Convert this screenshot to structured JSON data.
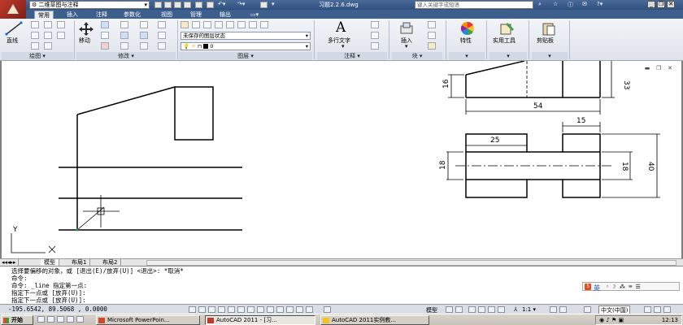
{
  "title": {
    "workspace": "二维草图与注释",
    "document": "习题2.2.6.dwg",
    "search_placeholder": "键入关键字或短语"
  },
  "tabs": [
    "常用",
    "插入",
    "注释",
    "参数化",
    "视图",
    "管理",
    "输出"
  ],
  "ribbon": {
    "line_label": "直线",
    "move_label": "移动",
    "layer_state": "未保存的图层状态",
    "layer_current": "0",
    "mtext_label": "多行文字",
    "insert_label": "插入",
    "properties_label": "特性",
    "utilities_label": "实用工具",
    "clipboard_label": "剪贴板",
    "panels": {
      "draw": "绘图",
      "modify": "修改",
      "layers": "图层",
      "annotation": "注释",
      "block": "块"
    }
  },
  "drawing": {
    "dims": [
      "16",
      "33",
      "54",
      "15",
      "25",
      "18",
      "18",
      "40"
    ],
    "ucs_x": "X",
    "ucs_y": "Y"
  },
  "layout_tabs": [
    "模型",
    "布局1",
    "布局2"
  ],
  "command_lines": [
    "选择要偏移的对象，或 [退出(E)/放弃(U)] <退出>:  *取消*",
    "命令:",
    "命令: _line 指定第一点:",
    "指定下一点或 [放弃(U)]:",
    "指定下一点或 [放弃(U)]:"
  ],
  "ime": {
    "lang": "英"
  },
  "status": {
    "coords": "-195.6542, 89.5068 , 0.0000",
    "model": "模型",
    "scale": "1:1",
    "lang": "中文(中国)"
  },
  "taskbar": {
    "start": "开始",
    "tasks": [
      "Microsoft PowerPoin...",
      "AutoCAD 2011 - [习...",
      "AutoCAD 2011实例教..."
    ],
    "time": "12:13"
  },
  "colors": {
    "ribbon_tab_bg": "#3d5f8e",
    "app_logo": "#c0392b"
  }
}
